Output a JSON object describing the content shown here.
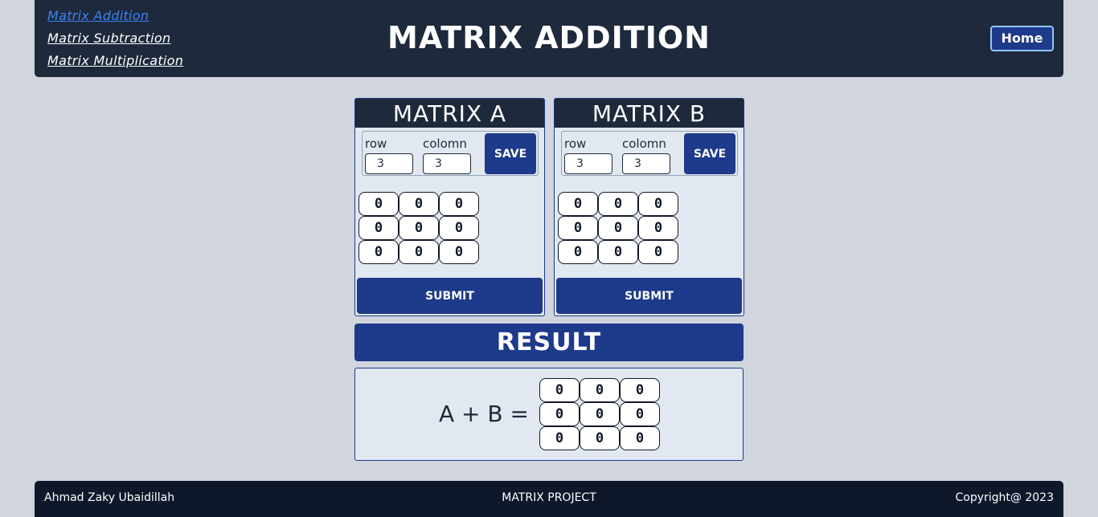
{
  "header": {
    "nav": [
      {
        "label": "Matrix Addition",
        "active": true
      },
      {
        "label": "Matrix Subtraction",
        "active": false
      },
      {
        "label": "Matrix Multiplication",
        "active": false
      }
    ],
    "title": "MATRIX ADDITION",
    "home_label": "Home"
  },
  "matrix_a": {
    "title": "MATRIX A",
    "row_label": "row",
    "col_label": "colomn",
    "row_value": "3",
    "col_value": "3",
    "save_label": "SAVE",
    "cells": [
      [
        "0",
        "0",
        "0"
      ],
      [
        "0",
        "0",
        "0"
      ],
      [
        "0",
        "0",
        "0"
      ]
    ],
    "submit_label": "SUBMIT"
  },
  "matrix_b": {
    "title": "MATRIX B",
    "row_label": "row",
    "col_label": "colomn",
    "row_value": "3",
    "col_value": "3",
    "save_label": "SAVE",
    "cells": [
      [
        "0",
        "0",
        "0"
      ],
      [
        "0",
        "0",
        "0"
      ],
      [
        "0",
        "0",
        "0"
      ]
    ],
    "submit_label": "SUBMIT"
  },
  "result": {
    "title": "RESULT",
    "expression": "A + B =",
    "cells": [
      [
        "0",
        "0",
        "0"
      ],
      [
        "0",
        "0",
        "0"
      ],
      [
        "0",
        "0",
        "0"
      ]
    ]
  },
  "footer": {
    "author": "Ahmad Zaky Ubaidillah",
    "project": "MATRIX PROJECT",
    "copyright": "Copyright@ 2023"
  },
  "colors": {
    "header_bg": "#1e293b",
    "accent": "#1e3a8a",
    "active_link": "#3b82f6",
    "page_bg": "#d1d5de",
    "footer_bg": "#0f172a"
  }
}
